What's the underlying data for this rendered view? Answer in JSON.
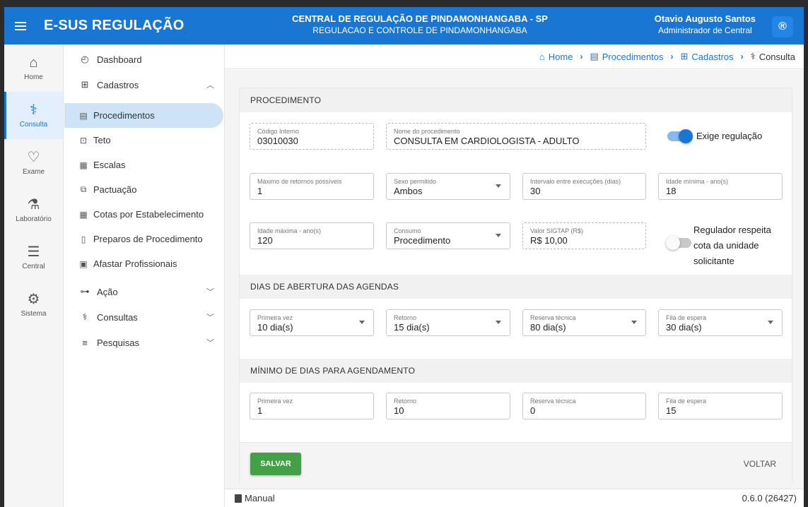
{
  "header": {
    "brand": "E-SUS REGULAÇÃO",
    "central_title": "CENTRAL DE REGULAÇÃO DE PINDAMONHANGABA - SP",
    "central_subtitle": "REGULACAO E CONTROLE DE PINDAMONHANGABA",
    "user_name": "Otavio Augusto Santos",
    "user_role": "Administrador de Central",
    "user_icon": "®"
  },
  "rail": [
    {
      "label": "Home",
      "icon": "⌂"
    },
    {
      "label": "Consulta",
      "icon": "⚕"
    },
    {
      "label": "Exame",
      "icon": "♡"
    },
    {
      "label": "Laboratório",
      "icon": "⚗"
    },
    {
      "label": "Central",
      "icon": "☰"
    },
    {
      "label": "Sistema",
      "icon": "⚙"
    }
  ],
  "sidebar": {
    "dashboard": "Dashboard",
    "cadastros": "Cadastros",
    "sub": [
      {
        "label": "Procedimentos",
        "icon": "▤"
      },
      {
        "label": "Teto",
        "icon": "⊡"
      },
      {
        "label": "Escalas",
        "icon": "▦"
      },
      {
        "label": "Pactuação",
        "icon": "⧉"
      },
      {
        "label": "Cotas por Estabelecimento",
        "icon": "▦"
      },
      {
        "label": "Preparos de Procedimento",
        "icon": "▯"
      },
      {
        "label": "Afastar Profissionais",
        "icon": "▣"
      }
    ],
    "acao": "Ação",
    "consultas": "Consultas",
    "pesquisas": "Pesquisas"
  },
  "breadcrumb": {
    "home": "Home",
    "procedimentos": "Procedimentos",
    "cadastros": "Cadastros",
    "current": "Consulta"
  },
  "form": {
    "section_procedimento": "PROCEDIMENTO",
    "codigo_label": "Código Interno",
    "codigo_value": "03010030",
    "nome_label": "Nome do procedimento",
    "nome_value": "CONSULTA EM CARDIOLOGISTA - ADULTO",
    "exige_regulacao": "Exige regulação",
    "max_retornos_label": "Máximo de retornos possíveis",
    "max_retornos_value": "1",
    "sexo_label": "Sexo permitido",
    "sexo_value": "Ambos",
    "intervalo_label": "Intervalo entre execuções (dias)",
    "intervalo_value": "30",
    "idade_min_label": "Idade mínima - ano(s)",
    "idade_min_value": "18",
    "idade_max_label": "Idade máxima - ano(s)",
    "idade_max_value": "120",
    "consumo_label": "Consumo",
    "consumo_value": "Procedimento",
    "valor_label": "Valor SIGTAP (R$)",
    "valor_value": "R$ 10,00",
    "regulador_line1": "Regulador respeita",
    "regulador_line2": "cota da unidade",
    "regulador_line3": "solicitante",
    "section_dias_abertura": "DIAS DE ABERTURA DAS AGENDAS",
    "ab_primeira_label": "Primeira vez",
    "ab_primeira_value": "10 dia(s)",
    "ab_retorno_label": "Retorno",
    "ab_retorno_value": "15 dia(s)",
    "ab_reserva_label": "Reserva técnica",
    "ab_reserva_value": "80 dia(s)",
    "ab_fila_label": "Fila de espera",
    "ab_fila_value": "30 dia(s)",
    "section_minimo": "MÍNIMO DE DIAS PARA AGENDAMENTO",
    "mi_primeira_label": "Primeira vez",
    "mi_primeira_value": "1",
    "mi_retorno_label": "Retorno",
    "mi_retorno_value": "10",
    "mi_reserva_label": "Reserva técnica",
    "mi_reserva_value": "0",
    "mi_fila_label": "Fila de espera",
    "mi_fila_value": "15",
    "save_label": "SALVAR",
    "back_label": "VOLTAR"
  },
  "toggles": {
    "exige_regulacao_on": true,
    "regulador_respeita_on": false
  },
  "status": {
    "manual": "Manual",
    "version": "0.6.0 (26427)"
  },
  "colors": {
    "primary": "#1976d2",
    "save": "#43a047"
  }
}
